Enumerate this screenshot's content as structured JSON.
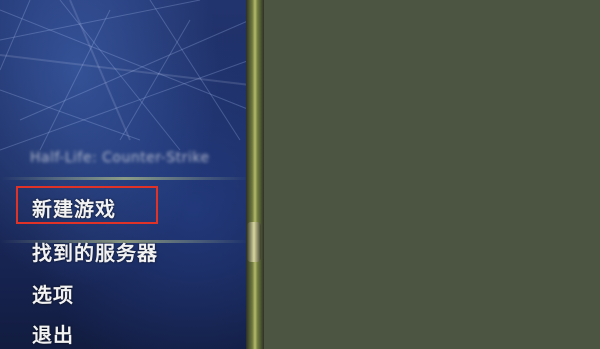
{
  "menu": {
    "subtitle": "Half-Life: Counter-Strike",
    "items": [
      {
        "label": "新建游戏"
      },
      {
        "label": "找到的服务器"
      },
      {
        "label": "选项"
      },
      {
        "label": "退出"
      }
    ]
  },
  "colors": {
    "background": "#4c5442",
    "panel": "#1c2c60",
    "highlight_border": "#e03226",
    "menu_text": "#f2f2f2"
  }
}
